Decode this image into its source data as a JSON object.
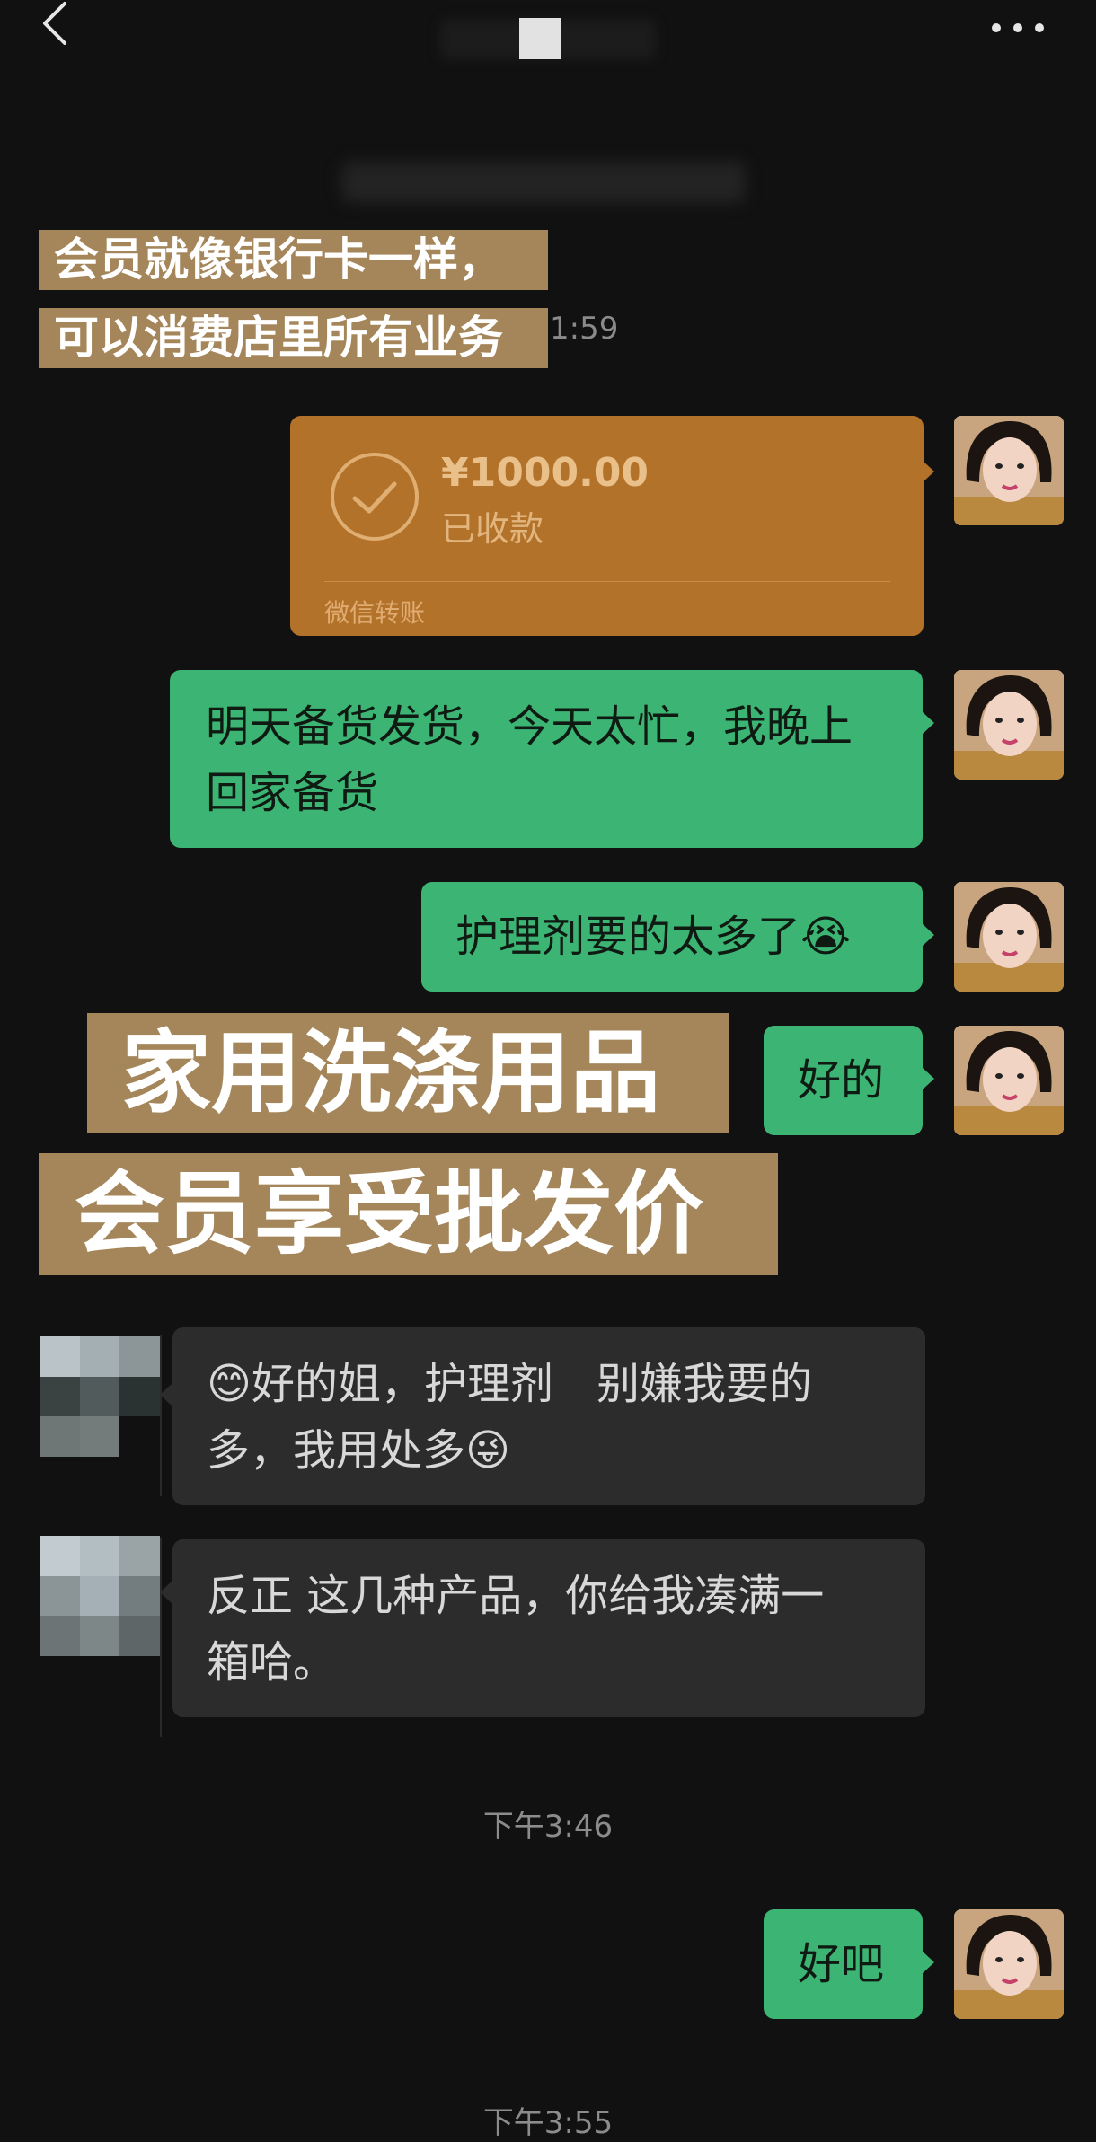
{
  "header": {
    "back_icon": "chevron-left-icon",
    "more_icon": "ellipsis-icon"
  },
  "top_time_fragment": "1:59",
  "overlays": {
    "line1": "会员就像银行卡一样，",
    "line2": "可以消费店里所有业务",
    "big1": "家用洗涤用品",
    "big2": "会员享受批发价"
  },
  "transfer": {
    "amount": "¥1000.00",
    "status": "已收款",
    "footer": "微信转账",
    "icon": "check-circle-icon",
    "color": "#b3722a"
  },
  "messages": [
    {
      "side": "right",
      "line1": "明天备货发货，今天太忙，我晚上",
      "line2": "回家备货"
    },
    {
      "side": "right",
      "text": "护理剂要的太多了",
      "emoji": "😭"
    },
    {
      "side": "right",
      "text": "好的"
    },
    {
      "side": "left",
      "emoji1": "😊",
      "line1": "好的姐，护理剂　别嫌我要的",
      "line2": "多，我用处多",
      "emoji2": "😜"
    },
    {
      "side": "left",
      "line1": "反正 这几种产品，你给我凑满一",
      "line2": "箱哈。"
    },
    {
      "side": "right",
      "text": "好吧"
    }
  ],
  "timestamps": {
    "t1": "下午3:46",
    "t2": "下午3:55"
  },
  "colors": {
    "background": "#111111",
    "green_bubble": "#3cb574",
    "gray_bubble": "#2c2c2c",
    "overlay": "#a4865a"
  }
}
